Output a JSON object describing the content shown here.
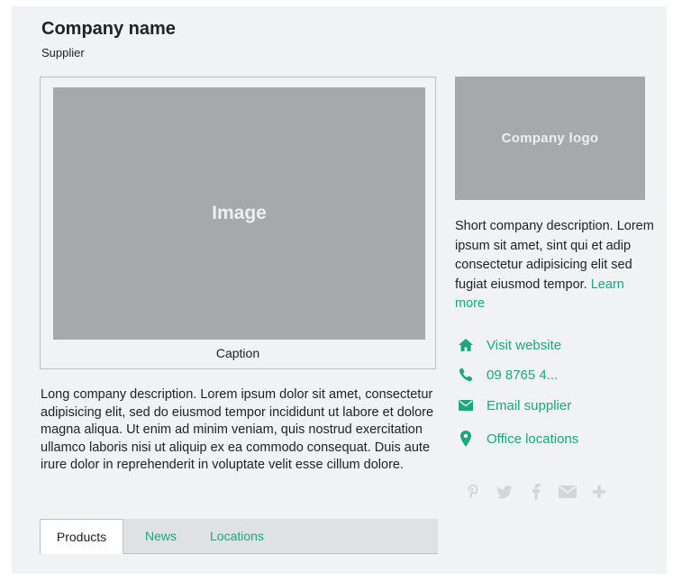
{
  "header": {
    "title": "Company name",
    "subtitle": "Supplier"
  },
  "media": {
    "image_label": "Image",
    "caption": "Caption"
  },
  "long_description": "Long company description. Lorem ipsum dolor sit amet, consectetur adipisicing elit, sed do eiusmod tempor incididunt ut labore et dolore magna aliqua. Ut enim ad minim veniam, quis nostrud exercitation ullamco laboris nisi ut aliquip ex ea commodo consequat. Duis aute irure dolor in reprehenderit in voluptate velit esse cillum dolore.",
  "tabs": [
    {
      "label": "Products",
      "active": true
    },
    {
      "label": "News",
      "active": false
    },
    {
      "label": "Locations",
      "active": false
    }
  ],
  "sidebar": {
    "logo_label": "Company logo",
    "short_description": "Short company description. Lorem ipsum sit amet, sint qui et adip consectetur adipisicing elit sed fugiat eiusmod tempor.",
    "learn_more": "Learn more",
    "contacts": [
      {
        "icon": "home-icon",
        "label": "Visit website"
      },
      {
        "icon": "phone-icon",
        "label": "09 8765 4..."
      },
      {
        "icon": "envelope-icon",
        "label": "Email supplier"
      },
      {
        "icon": "map-pin-icon",
        "label": "Office locations"
      }
    ],
    "social_icons": [
      "pinterest-icon",
      "twitter-icon",
      "facebook-icon",
      "email-share-icon",
      "plus-icon"
    ]
  },
  "colors": {
    "accent": "#1aa67e",
    "placeholder": "#a7a8ab",
    "panel": "#f1f2f4",
    "social_icon": "#d3d5d9"
  }
}
